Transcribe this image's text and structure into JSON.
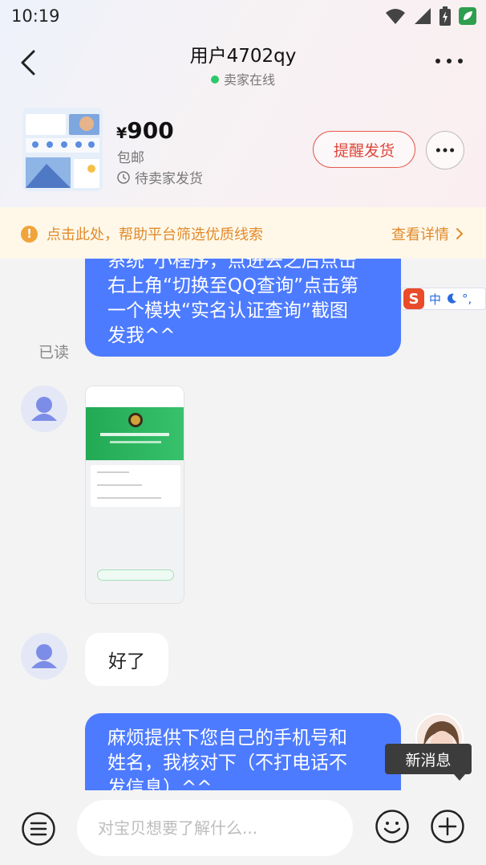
{
  "status_bar": {
    "time": "10:19",
    "icons": [
      "wifi-icon",
      "signal-icon",
      "battery-charging-icon",
      "app-notification-icon"
    ]
  },
  "nav": {
    "title": "用户4702qy",
    "seller_status": "卖家在线",
    "online_color": "#2bc86a"
  },
  "product": {
    "currency": "¥",
    "price": "900",
    "shipping": "包邮",
    "order_status": "待卖家发货",
    "remind_button": "提醒发货",
    "accent_color": "#e0463a"
  },
  "notice": {
    "icon": "!",
    "text": "点击此处，帮助平台筛选优质线索",
    "link": "查看详情",
    "color": "#e18a2a"
  },
  "chat": {
    "messages": [
      {
        "type": "text",
        "sender": "me",
        "lines": [
          "系统“小程序，点进去之后点击",
          "右上角“切换至QQ查询”点击第",
          "一个模块“实名认证查询”截图",
          "发我^^"
        ],
        "status": "已读"
      },
      {
        "type": "image",
        "sender": "other"
      },
      {
        "type": "text",
        "sender": "other",
        "text": "好了"
      },
      {
        "type": "text",
        "sender": "me",
        "lines": [
          "麻烦提供下您自己的手机号和",
          "姓名，我核对下（不打电话不",
          "发信息）^^"
        ]
      }
    ],
    "ime": {
      "mode": "中",
      "extra": "°,"
    },
    "new_message_tip": "新消息",
    "bubble_color": "#4d7bff"
  },
  "input": {
    "placeholder": "对宝贝想要了解什么..."
  }
}
